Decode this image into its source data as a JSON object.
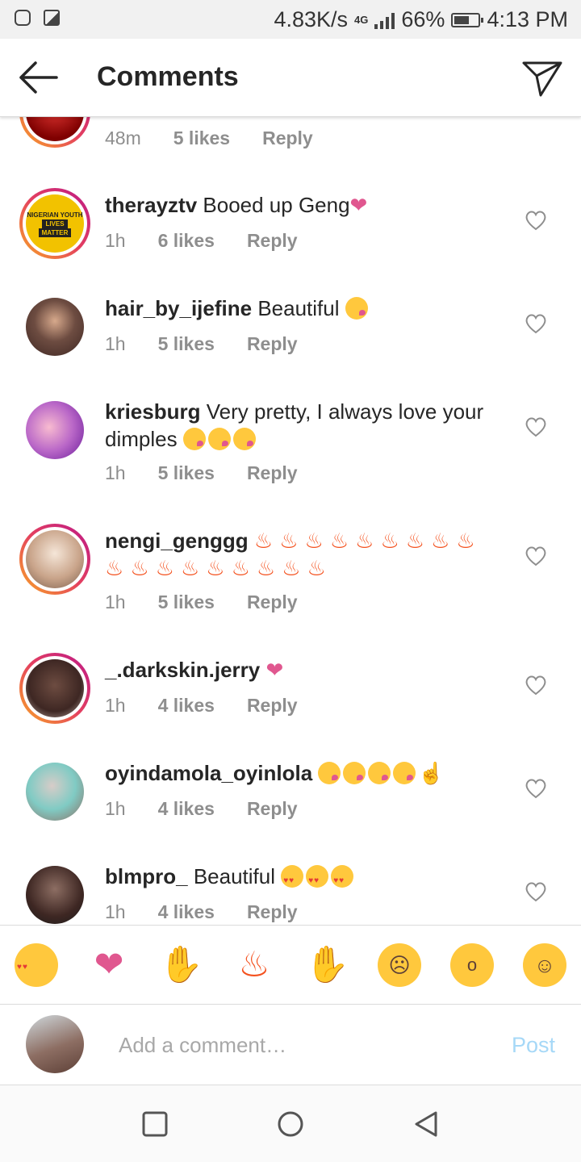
{
  "status_bar": {
    "speed": "4.83K/s",
    "network": "4G",
    "battery": "66%",
    "battery_level": 0.66,
    "time": "4:13 PM"
  },
  "header": {
    "title": "Comments"
  },
  "comments": [
    {
      "username": "",
      "text": "",
      "time": "48m",
      "likes": "5 likes",
      "reply": "Reply",
      "avatar_color": "#b71c1c"
    },
    {
      "username": "therayztv",
      "text": "Booed up Geng",
      "time": "1h",
      "likes": "6 likes",
      "reply": "Reply",
      "avatar_badge": [
        "NIGERIAN YOUTH",
        "LIVES",
        "MATTER"
      ],
      "avatar_color": "#f2c200"
    },
    {
      "username": "hair_by_ijefine",
      "text": "Beautiful",
      "time": "1h",
      "likes": "5 likes",
      "reply": "Reply",
      "avatar_color": "#6d4c41"
    },
    {
      "username": "kriesburg",
      "text": "Very pretty, I always love your dimples",
      "time": "1h",
      "likes": "5 likes",
      "reply": "Reply",
      "avatar_color": "#ce93d8"
    },
    {
      "username": "nengi_genggg",
      "text": "",
      "time": "1h",
      "likes": "5 likes",
      "reply": "Reply",
      "avatar_color": "#e0c9b3"
    },
    {
      "username": "_.darkskin.jerry",
      "text": "",
      "time": "1h",
      "likes": "4 likes",
      "reply": "Reply",
      "avatar_color": "#4e342e"
    },
    {
      "username": "oyindamola_oyinlola",
      "text": "",
      "time": "1h",
      "likes": "4 likes",
      "reply": "Reply",
      "avatar_color": "#80cbc4"
    },
    {
      "username": "blmpro_",
      "text": "Beautiful",
      "time": "1h",
      "likes": "4 likes",
      "reply": "Reply",
      "avatar_color": "#3e2723"
    }
  ],
  "reactions": [
    "heart-eyes-emoji",
    "heart-emoji",
    "raised-hands-emoji",
    "fire-emoji",
    "clapping-emoji",
    "sad-emoji",
    "surprised-emoji",
    "grinning-emoji"
  ],
  "composer": {
    "placeholder": "Add a comment…",
    "post_label": "Post"
  }
}
